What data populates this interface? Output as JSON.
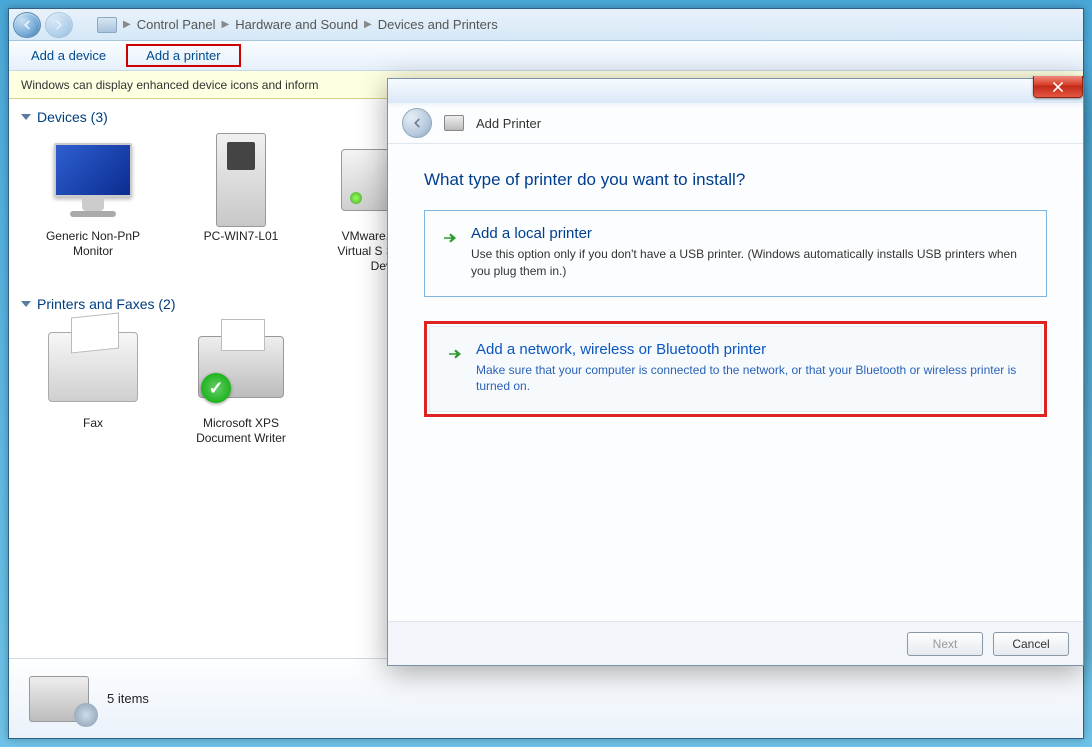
{
  "breadcrumb": {
    "item1": "Control Panel",
    "item2": "Hardware and Sound",
    "item3": "Devices and Printers"
  },
  "toolbar": {
    "add_device": "Add a device",
    "add_printer": "Add a printer"
  },
  "infostrip": {
    "text": "Windows can display enhanced device icons and inform"
  },
  "sections": {
    "devices_heading": "Devices (3)",
    "printers_heading": "Printers and Faxes (2)"
  },
  "devices": {
    "d0": "Generic Non-PnP Monitor",
    "d1": "PC-WIN7-L01",
    "d2": "VMware, VMware Virtual S SCSI Disk Device"
  },
  "printers": {
    "p0": "Fax",
    "p1": "Microsoft XPS Document Writer"
  },
  "statusbar": {
    "count": "5 items"
  },
  "dialog": {
    "header": "Add Printer",
    "title": "What type of printer do you want to install?",
    "opt1_title": "Add a local printer",
    "opt1_desc": "Use this option only if you don't have a USB printer. (Windows automatically installs USB printers when you plug them in.)",
    "opt2_title": "Add a network, wireless or Bluetooth printer",
    "opt2_desc": "Make sure that your computer is connected to the network, or that your Bluetooth or wireless printer is turned on.",
    "next": "Next",
    "cancel": "Cancel"
  }
}
